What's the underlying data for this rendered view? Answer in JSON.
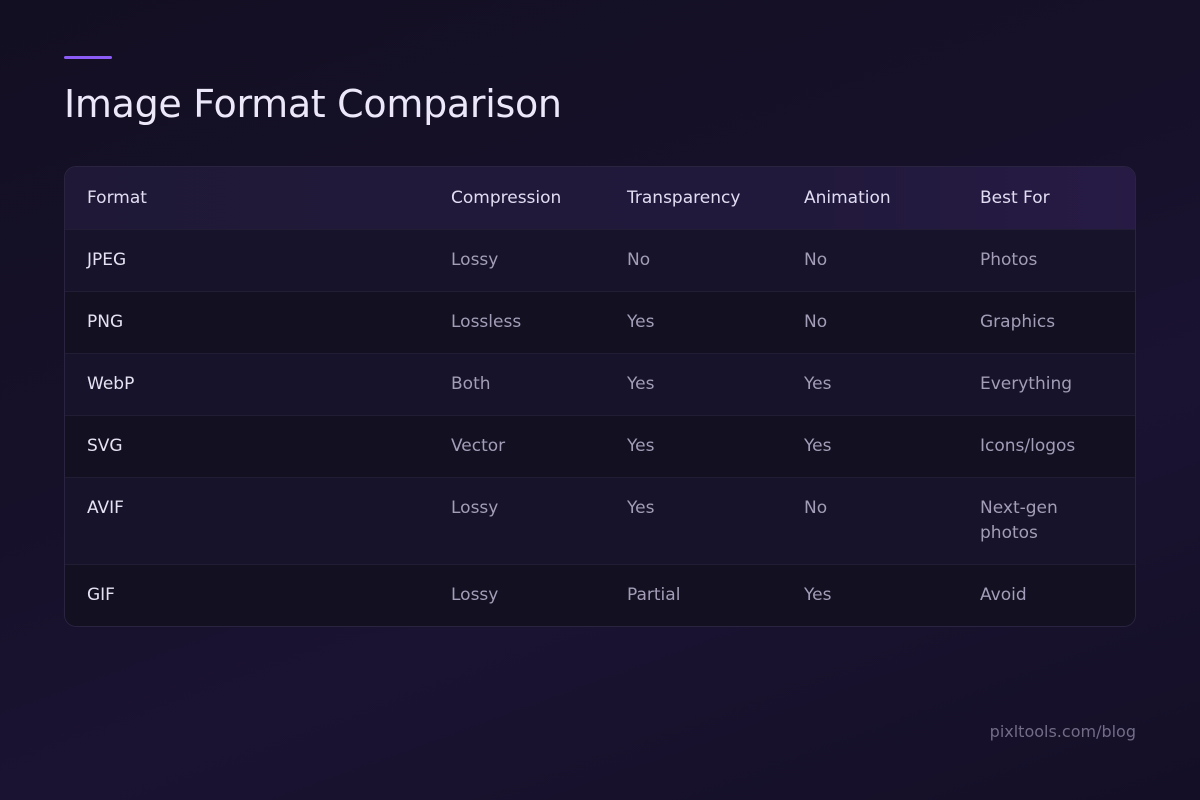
{
  "page": {
    "title": "Image Format Comparison",
    "credit": "pixltools.com/blog",
    "accent_color": "#8b5cf6"
  },
  "table": {
    "headers": {
      "format": "Format",
      "compression": "Compression",
      "transparency": "Transparency",
      "animation": "Animation",
      "best_for": "Best For"
    },
    "rows": [
      {
        "format": "JPEG",
        "compression": "Lossy",
        "transparency": "No",
        "animation": "No",
        "best_for": "Photos"
      },
      {
        "format": "PNG",
        "compression": "Lossless",
        "transparency": "Yes",
        "animation": "No",
        "best_for": "Graphics"
      },
      {
        "format": "WebP",
        "compression": "Both",
        "transparency": "Yes",
        "animation": "Yes",
        "best_for": "Everything"
      },
      {
        "format": "SVG",
        "compression": "Vector",
        "transparency": "Yes",
        "animation": "Yes",
        "best_for": "Icons/logos"
      },
      {
        "format": "AVIF",
        "compression": "Lossy",
        "transparency": "Yes",
        "animation": "No",
        "best_for": "Next-gen photos"
      },
      {
        "format": "GIF",
        "compression": "Lossy",
        "transparency": "Partial",
        "animation": "Yes",
        "best_for": "Avoid"
      }
    ]
  }
}
